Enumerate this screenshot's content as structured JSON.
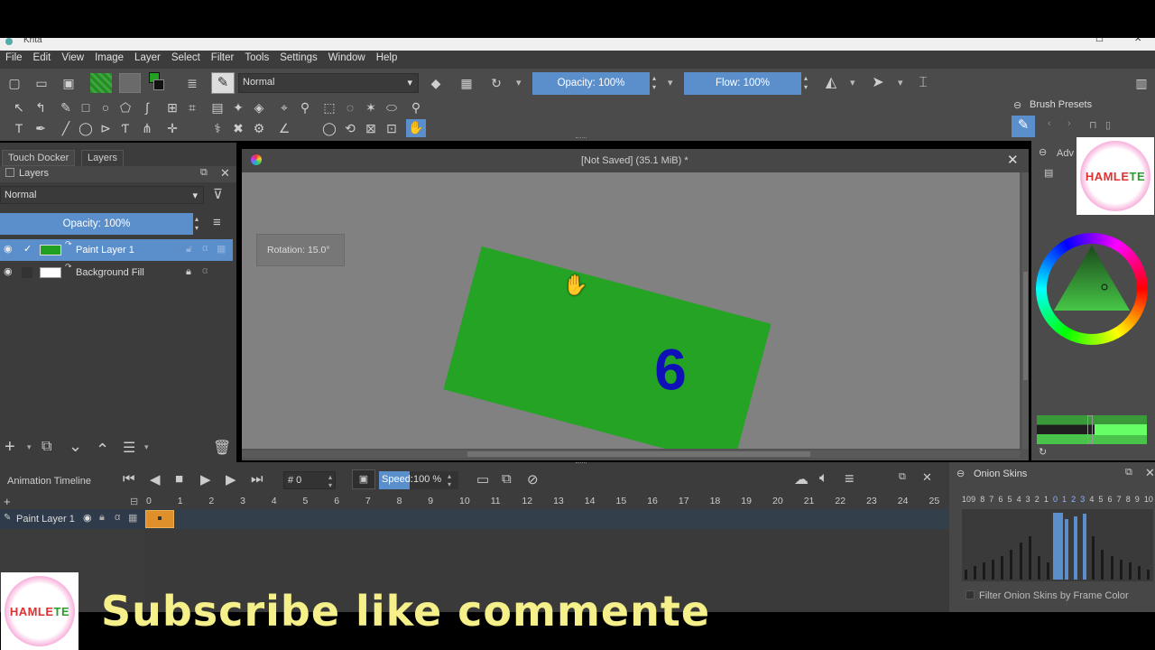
{
  "app": {
    "title": "Krita"
  },
  "menu": [
    "File",
    "Edit",
    "View",
    "Image",
    "Layer",
    "Select",
    "Filter",
    "Tools",
    "Settings",
    "Window",
    "Help"
  ],
  "toolbar": {
    "blend_mode": "Normal",
    "opacity_label": "Opacity: 100%",
    "flow_label": "Flow: 100%"
  },
  "layers_dock": {
    "tabs": [
      "Touch Docker",
      "Layers"
    ],
    "title": "Layers",
    "blend_mode": "Normal",
    "opacity_label": "Opacity:  100%",
    "layers": [
      {
        "name": "Paint Layer 1",
        "selected": true,
        "thumb_color": "#22a022"
      },
      {
        "name": "Background Fill",
        "selected": false,
        "thumb_color": "#ffffff"
      }
    ]
  },
  "canvas": {
    "doc_title": "[Not Saved]  (35.1 MiB) *",
    "rotation_tip": "Rotation: 15.0°",
    "shape_color": "#24a324",
    "number_text": "6",
    "number_color": "#1010b8",
    "background": "#818181"
  },
  "right_dock": {
    "brush_presets_label": "Brush Presets",
    "adv_label": "Adv"
  },
  "timeline": {
    "title": "Animation Timeline",
    "frame_field": "# 0",
    "speed_label": "Speed:",
    "speed_value": "100 %",
    "frame_numbers": [
      "0",
      "1",
      "2",
      "3",
      "4",
      "5",
      "6",
      "7",
      "8",
      "9",
      "10",
      "11",
      "12",
      "13",
      "14",
      "15",
      "16",
      "17",
      "18",
      "19",
      "20",
      "21",
      "22",
      "23",
      "24",
      "25"
    ],
    "layer_name": "Paint Layer 1"
  },
  "onion": {
    "title": "Onion Skins",
    "labels": [
      "-10",
      "-9",
      "-8",
      "-7",
      "-6",
      "-5",
      "-4",
      "-3",
      "-2",
      "-1",
      "0",
      "1",
      "2",
      "3",
      "4",
      "5",
      "6",
      "7",
      "8",
      "9",
      "10"
    ],
    "levels": [
      0.15,
      0.2,
      0.25,
      0.3,
      0.35,
      0.45,
      0.55,
      0.65,
      0.35,
      0.25,
      1.0,
      0.9,
      0.95,
      0.98,
      0.65,
      0.45,
      0.35,
      0.3,
      0.25,
      0.2,
      0.15
    ],
    "active": [
      false,
      false,
      false,
      false,
      false,
      false,
      false,
      false,
      false,
      false,
      true,
      true,
      true,
      true,
      false,
      false,
      false,
      false,
      false,
      false,
      false
    ],
    "filter_label": "Filter Onion Skins by Frame Color"
  },
  "overlay": {
    "subscribe_text": "Subscribe like commente",
    "logo_text_a": "HAMLE",
    "logo_text_b": "TE"
  }
}
